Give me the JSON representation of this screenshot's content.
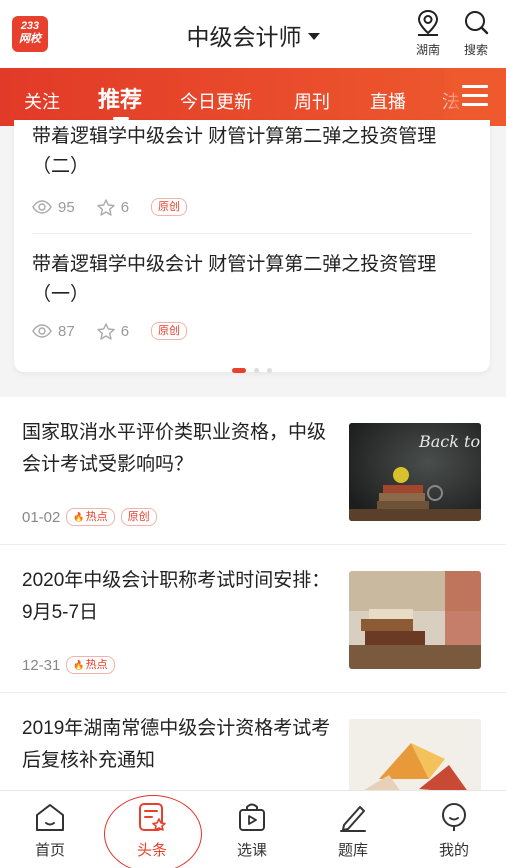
{
  "header": {
    "logo_top": "233",
    "logo_bottom": "网校",
    "title": "中级会计师",
    "location_label": "湖南",
    "search_label": "搜索"
  },
  "tabs": [
    {
      "label": "关注"
    },
    {
      "label": "推荐"
    },
    {
      "label": "今日更新"
    },
    {
      "label": "周刊"
    },
    {
      "label": "直播"
    },
    {
      "label": "法"
    }
  ],
  "carousel": {
    "items": [
      {
        "title": "带着逻辑学中级会计 财管计算第二弹之投资管理（二）",
        "views": "95",
        "stars": "6",
        "tag": "原创"
      },
      {
        "title": "带着逻辑学中级会计 财管计算第二弹之投资管理（一）",
        "views": "87",
        "stars": "6",
        "tag": "原创"
      }
    ]
  },
  "news": [
    {
      "title": "国家取消水平评价类职业资格，中级会计考试受影响吗？",
      "date": "01-02",
      "tags": [
        "热点",
        "原创"
      ],
      "thumb_text": "Back to school"
    },
    {
      "title": "2020年中级会计职称考试时间安排：9月5-7日",
      "date": "12-31",
      "tags": [
        "热点"
      ]
    },
    {
      "title": "2019年湖南常德中级会计资格考试考后复核补充通知",
      "date": "",
      "tags": []
    }
  ],
  "bottom_nav": [
    {
      "label": "首页",
      "icon": "home-icon"
    },
    {
      "label": "头条",
      "icon": "news-icon"
    },
    {
      "label": "选课",
      "icon": "course-bag-icon"
    },
    {
      "label": "题库",
      "icon": "pencil-icon"
    },
    {
      "label": "我的",
      "icon": "profile-icon"
    }
  ],
  "colors": {
    "accent": "#e8402c",
    "tab_bg": "#e23a28"
  }
}
